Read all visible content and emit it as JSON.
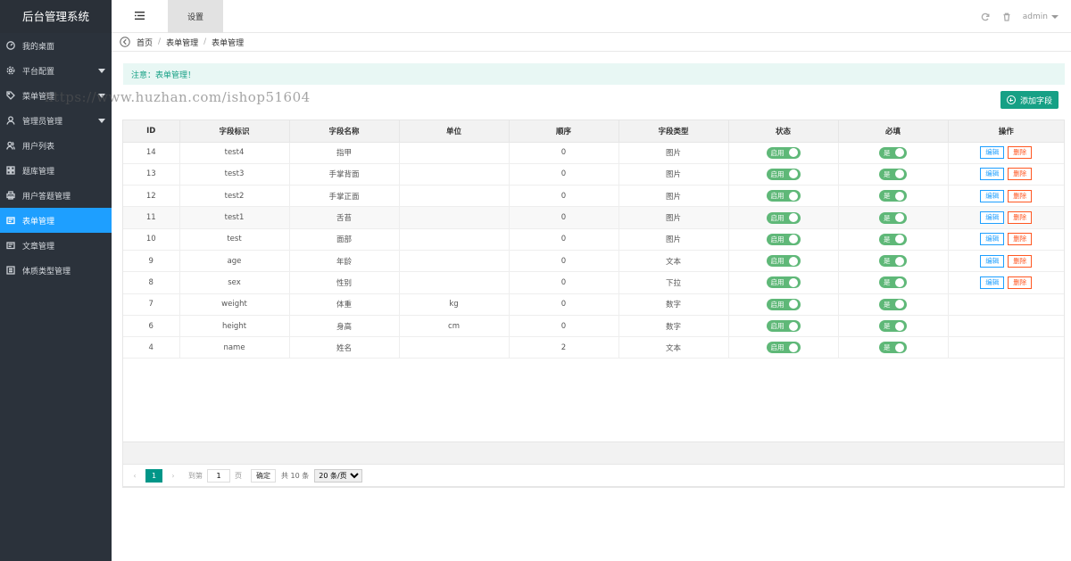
{
  "app_title": "后台管理系统",
  "sidebar": {
    "items": [
      {
        "label": "我的桌面",
        "icon": "dashboard-icon"
      },
      {
        "label": "平台配置",
        "icon": "gear-icon",
        "expandable": true
      },
      {
        "label": "菜单管理",
        "icon": "tag-icon",
        "expandable": true
      },
      {
        "label": "管理员管理",
        "icon": "user-icon",
        "expandable": true
      },
      {
        "label": "用户列表",
        "icon": "users-icon"
      },
      {
        "label": "题库管理",
        "icon": "grid-icon"
      },
      {
        "label": "用户答题管理",
        "icon": "print-icon"
      },
      {
        "label": "表单管理",
        "icon": "form-icon",
        "active": true
      },
      {
        "label": "文章管理",
        "icon": "form-icon"
      },
      {
        "label": "体质类型管理",
        "icon": "list-icon"
      }
    ]
  },
  "topbar": {
    "tab_label": "设置",
    "user": "admin"
  },
  "breadcrumb": [
    "首页",
    "表单管理",
    "表单管理"
  ],
  "notice": "注意：表单管理！",
  "add_button": "添加字段",
  "watermark": "https://www.huzhan.com/ishop51604",
  "table": {
    "columns": [
      "ID",
      "字段标识",
      "字段名称",
      "单位",
      "顺序",
      "字段类型",
      "状态",
      "必填",
      "操作"
    ],
    "rows": [
      {
        "id": "14",
        "key": "test4",
        "name": "指甲",
        "unit": "",
        "order": "0",
        "type": "图片",
        "status": "启用",
        "required": "是",
        "ops": true
      },
      {
        "id": "13",
        "key": "test3",
        "name": "手掌背面",
        "unit": "",
        "order": "0",
        "type": "图片",
        "status": "启用",
        "required": "是",
        "ops": true
      },
      {
        "id": "12",
        "key": "test2",
        "name": "手掌正面",
        "unit": "",
        "order": "0",
        "type": "图片",
        "status": "启用",
        "required": "是",
        "ops": true
      },
      {
        "id": "11",
        "key": "test1",
        "name": "舌苔",
        "unit": "",
        "order": "0",
        "type": "图片",
        "status": "启用",
        "required": "是",
        "ops": true
      },
      {
        "id": "10",
        "key": "test",
        "name": "面部",
        "unit": "",
        "order": "0",
        "type": "图片",
        "status": "启用",
        "required": "是",
        "ops": true
      },
      {
        "id": "9",
        "key": "age",
        "name": "年龄",
        "unit": "",
        "order": "0",
        "type": "文本",
        "status": "启用",
        "required": "是",
        "ops": true
      },
      {
        "id": "8",
        "key": "sex",
        "name": "性别",
        "unit": "",
        "order": "0",
        "type": "下拉",
        "status": "启用",
        "required": "是",
        "ops": true
      },
      {
        "id": "7",
        "key": "weight",
        "name": "体重",
        "unit": "kg",
        "order": "0",
        "type": "数字",
        "status": "启用",
        "required": "是",
        "ops": false
      },
      {
        "id": "6",
        "key": "height",
        "name": "身高",
        "unit": "cm",
        "order": "0",
        "type": "数字",
        "status": "启用",
        "required": "是",
        "ops": false
      },
      {
        "id": "4",
        "key": "name",
        "name": "姓名",
        "unit": "",
        "order": "2",
        "type": "文本",
        "status": "启用",
        "required": "是",
        "ops": false
      }
    ],
    "edit_label": "编辑",
    "delete_label": "删除"
  },
  "pager": {
    "current_page": "1",
    "goto_label": "到第",
    "page_input": "1",
    "page_unit": "页",
    "confirm": "确定",
    "total": "共 10 条",
    "page_size": "20 条/页"
  },
  "colors": {
    "sidebar_bg": "#2b323b",
    "active": "#1e9fff",
    "brand": "#16a085",
    "switch_on": "#5fb878"
  }
}
